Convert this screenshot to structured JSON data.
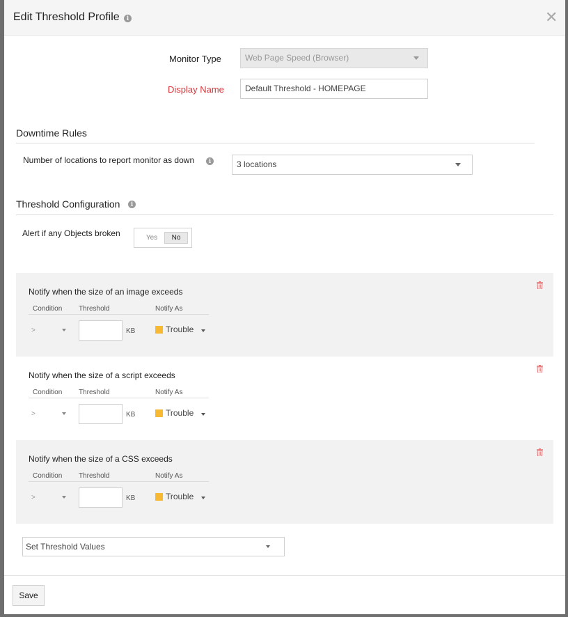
{
  "dialog": {
    "title": "Edit Threshold Profile"
  },
  "form": {
    "monitor_type_label": "Monitor Type",
    "monitor_type_value": "Web Page Speed (Browser)",
    "display_name_label": "Display Name",
    "display_name_value": "Default Threshold - HOMEPAGE"
  },
  "downtime": {
    "title": "Downtime Rules",
    "locations_label": "Number of locations to report monitor as down",
    "locations_value": "3 locations"
  },
  "threshold_config": {
    "title": "Threshold Configuration",
    "objects_broken_label": "Alert if any Objects broken",
    "toggle_yes": "Yes",
    "toggle_no": "No"
  },
  "columns": {
    "condition": "Condition",
    "threshold": "Threshold",
    "notify_as": "Notify As"
  },
  "rules": [
    {
      "title": "Notify when the size of an image exceeds",
      "condition": ">",
      "unit": "KB",
      "notify": "Trouble"
    },
    {
      "title": "Notify when the size of a script exceeds",
      "condition": ">",
      "unit": "KB",
      "notify": "Trouble"
    },
    {
      "title": "Notify when the size of a CSS exceeds",
      "condition": ">",
      "unit": "KB",
      "notify": "Trouble"
    }
  ],
  "set_threshold": {
    "value": "Set Threshold Values"
  },
  "footer": {
    "save_label": "Save"
  },
  "colors": {
    "trouble": "#f7b932",
    "required_label": "#d9373c",
    "delete_icon": "#e07a7a"
  }
}
